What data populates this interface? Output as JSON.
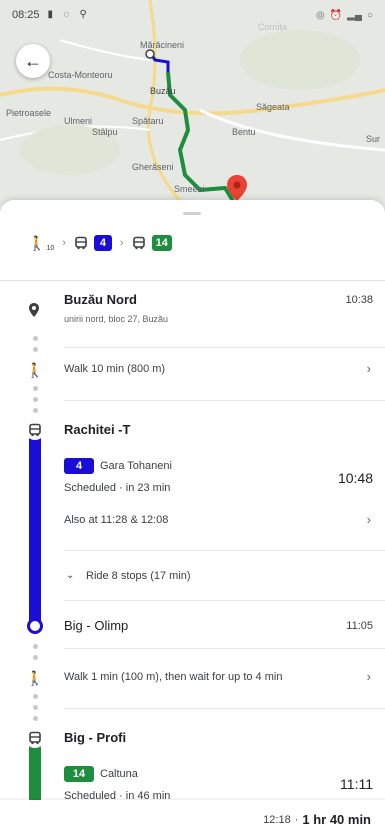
{
  "status_bar": {
    "time": "08:25"
  },
  "map": {
    "labels": {
      "maracineni": "Mărăcineni",
      "monteoru": "Costa-Monteoru",
      "buzau": "Buzău",
      "sageata": "Săgeata",
      "pietroasele": "Pietroasele",
      "ulmeni": "Ulmeni",
      "stalpu": "Stâlpu",
      "spataru": "Spătaru",
      "bentu": "Bentu",
      "sur": "Sur",
      "gheraseni": "Gherăseni",
      "smeeni": "Smeeni",
      "cornita": "Cornița"
    },
    "route_colors": {
      "bus_4": "#1a0dd6",
      "bus_14": "#1e8e3e"
    }
  },
  "summary": {
    "walk_minutes": "10",
    "line_1": "4",
    "line_2": "14"
  },
  "steps": {
    "origin": {
      "name": "Buzău Nord",
      "address": "unirii nord, bloc 27, Buzău",
      "time": "10:38"
    },
    "walk_1": {
      "text": "Walk 10 min (800 m)"
    },
    "board_1": {
      "stop": "Rachitei -T",
      "line": "4",
      "headsign": "Gara Tohaneni",
      "schedule": "Scheduled · in 23 min",
      "time": "10:48",
      "also_at": "Also at 11:28 & 12:08",
      "ride": "Ride 8 stops (17 min)"
    },
    "alight_1": {
      "stop": "Big - Olimp",
      "time": "11:05"
    },
    "walk_2": {
      "text": "Walk 1 min (100 m), then wait for up to 4 min"
    },
    "board_2": {
      "stop": "Big - Profi",
      "line": "14",
      "headsign": "Caltuna",
      "schedule": "Scheduled · in 46 min",
      "time": "11:11"
    }
  },
  "footer": {
    "arrival": "12:18",
    "separator": "·",
    "duration": "1 hr 40 min"
  }
}
